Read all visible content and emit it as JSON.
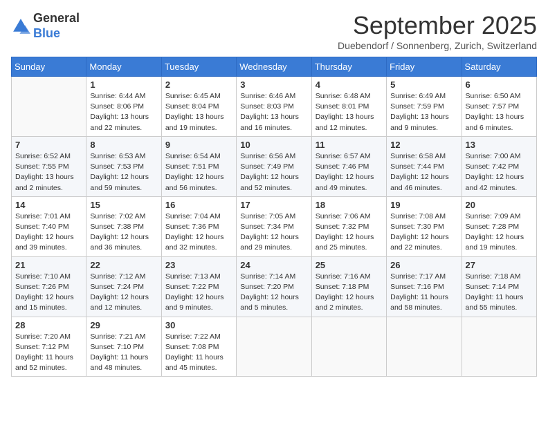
{
  "header": {
    "logo_general": "General",
    "logo_blue": "Blue",
    "month_title": "September 2025",
    "subtitle": "Duebendorf / Sonnenberg, Zurich, Switzerland"
  },
  "calendar": {
    "days_of_week": [
      "Sunday",
      "Monday",
      "Tuesday",
      "Wednesday",
      "Thursday",
      "Friday",
      "Saturday"
    ],
    "weeks": [
      [
        {
          "day": "",
          "info": ""
        },
        {
          "day": "1",
          "info": "Sunrise: 6:44 AM\nSunset: 8:06 PM\nDaylight: 13 hours\nand 22 minutes."
        },
        {
          "day": "2",
          "info": "Sunrise: 6:45 AM\nSunset: 8:04 PM\nDaylight: 13 hours\nand 19 minutes."
        },
        {
          "day": "3",
          "info": "Sunrise: 6:46 AM\nSunset: 8:03 PM\nDaylight: 13 hours\nand 16 minutes."
        },
        {
          "day": "4",
          "info": "Sunrise: 6:48 AM\nSunset: 8:01 PM\nDaylight: 13 hours\nand 12 minutes."
        },
        {
          "day": "5",
          "info": "Sunrise: 6:49 AM\nSunset: 7:59 PM\nDaylight: 13 hours\nand 9 minutes."
        },
        {
          "day": "6",
          "info": "Sunrise: 6:50 AM\nSunset: 7:57 PM\nDaylight: 13 hours\nand 6 minutes."
        }
      ],
      [
        {
          "day": "7",
          "info": "Sunrise: 6:52 AM\nSunset: 7:55 PM\nDaylight: 13 hours\nand 2 minutes."
        },
        {
          "day": "8",
          "info": "Sunrise: 6:53 AM\nSunset: 7:53 PM\nDaylight: 12 hours\nand 59 minutes."
        },
        {
          "day": "9",
          "info": "Sunrise: 6:54 AM\nSunset: 7:51 PM\nDaylight: 12 hours\nand 56 minutes."
        },
        {
          "day": "10",
          "info": "Sunrise: 6:56 AM\nSunset: 7:49 PM\nDaylight: 12 hours\nand 52 minutes."
        },
        {
          "day": "11",
          "info": "Sunrise: 6:57 AM\nSunset: 7:46 PM\nDaylight: 12 hours\nand 49 minutes."
        },
        {
          "day": "12",
          "info": "Sunrise: 6:58 AM\nSunset: 7:44 PM\nDaylight: 12 hours\nand 46 minutes."
        },
        {
          "day": "13",
          "info": "Sunrise: 7:00 AM\nSunset: 7:42 PM\nDaylight: 12 hours\nand 42 minutes."
        }
      ],
      [
        {
          "day": "14",
          "info": "Sunrise: 7:01 AM\nSunset: 7:40 PM\nDaylight: 12 hours\nand 39 minutes."
        },
        {
          "day": "15",
          "info": "Sunrise: 7:02 AM\nSunset: 7:38 PM\nDaylight: 12 hours\nand 36 minutes."
        },
        {
          "day": "16",
          "info": "Sunrise: 7:04 AM\nSunset: 7:36 PM\nDaylight: 12 hours\nand 32 minutes."
        },
        {
          "day": "17",
          "info": "Sunrise: 7:05 AM\nSunset: 7:34 PM\nDaylight: 12 hours\nand 29 minutes."
        },
        {
          "day": "18",
          "info": "Sunrise: 7:06 AM\nSunset: 7:32 PM\nDaylight: 12 hours\nand 25 minutes."
        },
        {
          "day": "19",
          "info": "Sunrise: 7:08 AM\nSunset: 7:30 PM\nDaylight: 12 hours\nand 22 minutes."
        },
        {
          "day": "20",
          "info": "Sunrise: 7:09 AM\nSunset: 7:28 PM\nDaylight: 12 hours\nand 19 minutes."
        }
      ],
      [
        {
          "day": "21",
          "info": "Sunrise: 7:10 AM\nSunset: 7:26 PM\nDaylight: 12 hours\nand 15 minutes."
        },
        {
          "day": "22",
          "info": "Sunrise: 7:12 AM\nSunset: 7:24 PM\nDaylight: 12 hours\nand 12 minutes."
        },
        {
          "day": "23",
          "info": "Sunrise: 7:13 AM\nSunset: 7:22 PM\nDaylight: 12 hours\nand 9 minutes."
        },
        {
          "day": "24",
          "info": "Sunrise: 7:14 AM\nSunset: 7:20 PM\nDaylight: 12 hours\nand 5 minutes."
        },
        {
          "day": "25",
          "info": "Sunrise: 7:16 AM\nSunset: 7:18 PM\nDaylight: 12 hours\nand 2 minutes."
        },
        {
          "day": "26",
          "info": "Sunrise: 7:17 AM\nSunset: 7:16 PM\nDaylight: 11 hours\nand 58 minutes."
        },
        {
          "day": "27",
          "info": "Sunrise: 7:18 AM\nSunset: 7:14 PM\nDaylight: 11 hours\nand 55 minutes."
        }
      ],
      [
        {
          "day": "28",
          "info": "Sunrise: 7:20 AM\nSunset: 7:12 PM\nDaylight: 11 hours\nand 52 minutes."
        },
        {
          "day": "29",
          "info": "Sunrise: 7:21 AM\nSunset: 7:10 PM\nDaylight: 11 hours\nand 48 minutes."
        },
        {
          "day": "30",
          "info": "Sunrise: 7:22 AM\nSunset: 7:08 PM\nDaylight: 11 hours\nand 45 minutes."
        },
        {
          "day": "",
          "info": ""
        },
        {
          "day": "",
          "info": ""
        },
        {
          "day": "",
          "info": ""
        },
        {
          "day": "",
          "info": ""
        }
      ]
    ]
  }
}
